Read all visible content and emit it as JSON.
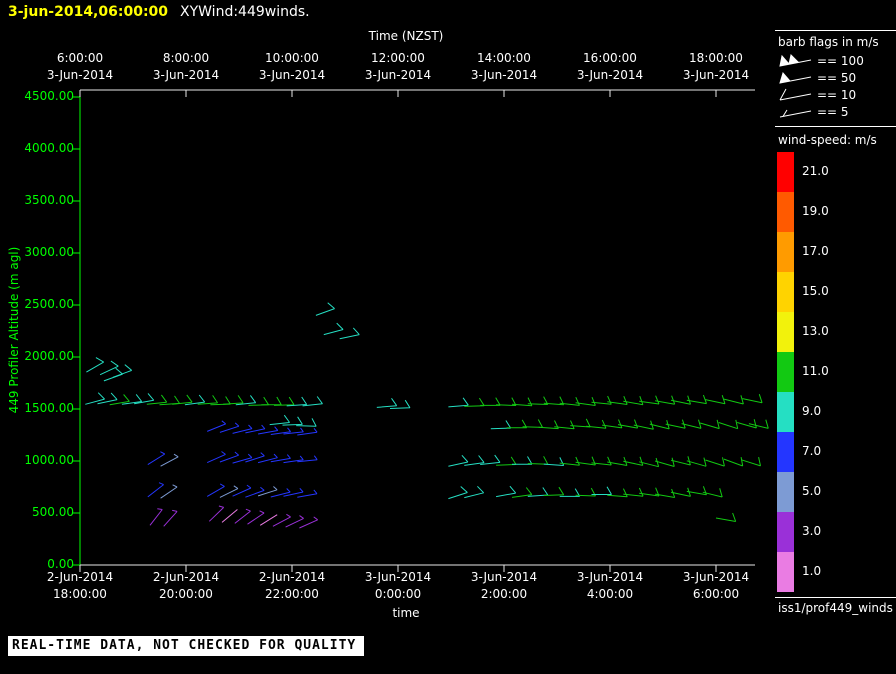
{
  "header": {
    "timestamp": "3-jun-2014,06:00:00",
    "title": "XYWind:449winds."
  },
  "chart_data": {
    "type": "windbarb-time-height",
    "top_axis": {
      "title": "Time (NZST)",
      "ticks": [
        {
          "time": "6:00:00",
          "date": "3-Jun-2014"
        },
        {
          "time": "8:00:00",
          "date": "3-Jun-2014"
        },
        {
          "time": "10:00:00",
          "date": "3-Jun-2014"
        },
        {
          "time": "12:00:00",
          "date": "3-Jun-2014"
        },
        {
          "time": "14:00:00",
          "date": "3-Jun-2014"
        },
        {
          "time": "16:00:00",
          "date": "3-Jun-2014"
        },
        {
          "time": "18:00:00",
          "date": "3-Jun-2014"
        }
      ]
    },
    "bottom_axis": {
      "title": "time",
      "ticks": [
        {
          "date": "2-Jun-2014",
          "time": "18:00:00"
        },
        {
          "date": "2-Jun-2014",
          "time": "20:00:00"
        },
        {
          "date": "2-Jun-2014",
          "time": "22:00:00"
        },
        {
          "date": "3-Jun-2014",
          "time": "0:00:00"
        },
        {
          "date": "3-Jun-2014",
          "time": "2:00:00"
        },
        {
          "date": "3-Jun-2014",
          "time": "4:00:00"
        },
        {
          "date": "3-Jun-2014",
          "time": "6:00:00"
        }
      ]
    },
    "y_axis": {
      "title": "449 Profiler Altitude (m agl)",
      "min": 0,
      "max": 4500,
      "ticks": [
        "0.00",
        "500.00",
        "1000.00",
        "1500.00",
        "2000.00",
        "2500.00",
        "3000.00",
        "3500.00",
        "4000.00",
        "4500.00"
      ]
    },
    "x_hours_range": [
      0,
      12.7
    ],
    "barb_fields": [
      "t_hours_from_plot_start",
      "altitude_m_agl",
      "speed_m_s",
      "direction_deg"
    ],
    "barbs": [
      [
        0.12,
        1855,
        9,
        60
      ],
      [
        0.38,
        1830,
        9,
        65
      ],
      [
        0.62,
        1805,
        9,
        70
      ],
      [
        0.45,
        1770,
        8,
        70
      ],
      [
        0.1,
        1545,
        9,
        75
      ],
      [
        0.33,
        1550,
        9,
        78
      ],
      [
        0.56,
        1540,
        10,
        80
      ],
      [
        0.79,
        1545,
        9,
        82
      ],
      [
        1.02,
        1550,
        9,
        80
      ],
      [
        1.26,
        1545,
        10,
        84
      ],
      [
        1.5,
        1540,
        11,
        86
      ],
      [
        1.74,
        1545,
        10,
        84
      ],
      [
        1.98,
        1540,
        9,
        82
      ],
      [
        2.22,
        1545,
        10,
        86
      ],
      [
        2.46,
        1540,
        11,
        88
      ],
      [
        2.7,
        1545,
        10,
        86
      ],
      [
        2.94,
        1540,
        9,
        84
      ],
      [
        3.18,
        1535,
        10,
        88
      ],
      [
        3.42,
        1540,
        11,
        90
      ],
      [
        3.66,
        1535,
        10,
        88
      ],
      [
        3.9,
        1530,
        9,
        86
      ],
      [
        4.2,
        1530,
        9,
        84
      ],
      [
        5.6,
        1515,
        9,
        85
      ],
      [
        5.85,
        1505,
        9,
        88
      ],
      [
        6.95,
        1520,
        9,
        85
      ],
      [
        7.25,
        1525,
        10,
        88
      ],
      [
        7.55,
        1535,
        11,
        90
      ],
      [
        7.85,
        1540,
        10,
        92
      ],
      [
        8.15,
        1545,
        11,
        94
      ],
      [
        8.45,
        1550,
        11,
        92
      ],
      [
        8.75,
        1555,
        10,
        94
      ],
      [
        9.05,
        1555,
        11,
        96
      ],
      [
        9.35,
        1560,
        11,
        98
      ],
      [
        9.65,
        1565,
        10,
        96
      ],
      [
        9.95,
        1570,
        11,
        98
      ],
      [
        10.25,
        1575,
        11,
        100
      ],
      [
        10.55,
        1575,
        10,
        98
      ],
      [
        10.85,
        1580,
        11,
        100
      ],
      [
        11.15,
        1585,
        11,
        102
      ],
      [
        11.45,
        1585,
        10,
        100
      ],
      [
        11.8,
        1590,
        11,
        102
      ],
      [
        12.15,
        1595,
        11,
        104
      ],
      [
        12.5,
        1600,
        11,
        102
      ],
      [
        4.45,
        2400,
        9,
        70
      ],
      [
        4.6,
        2215,
        9,
        75
      ],
      [
        4.9,
        2175,
        9,
        78
      ],
      [
        2.4,
        1285,
        7,
        68
      ],
      [
        2.64,
        1275,
        7,
        72
      ],
      [
        2.88,
        1265,
        7,
        76
      ],
      [
        3.12,
        1270,
        7,
        78
      ],
      [
        3.36,
        1260,
        7,
        80
      ],
      [
        3.6,
        1255,
        7,
        82
      ],
      [
        3.84,
        1260,
        7,
        84
      ],
      [
        4.1,
        1250,
        7,
        82
      ],
      [
        3.58,
        1350,
        9,
        84
      ],
      [
        3.82,
        1345,
        9,
        88
      ],
      [
        4.08,
        1340,
        9,
        92
      ],
      [
        7.75,
        1310,
        9,
        88
      ],
      [
        8.05,
        1320,
        10,
        90
      ],
      [
        8.35,
        1330,
        11,
        92
      ],
      [
        8.65,
        1325,
        10,
        94
      ],
      [
        8.95,
        1330,
        11,
        96
      ],
      [
        9.25,
        1340,
        11,
        94
      ],
      [
        9.55,
        1335,
        10,
        96
      ],
      [
        9.85,
        1345,
        11,
        98
      ],
      [
        10.15,
        1350,
        11,
        100
      ],
      [
        10.45,
        1345,
        10,
        102
      ],
      [
        10.75,
        1355,
        11,
        104
      ],
      [
        11.05,
        1355,
        11,
        102
      ],
      [
        11.35,
        1360,
        10,
        104
      ],
      [
        11.7,
        1365,
        11,
        106
      ],
      [
        12.05,
        1370,
        11,
        108
      ],
      [
        12.4,
        1370,
        11,
        106
      ],
      [
        12.62,
        1360,
        11,
        104
      ],
      [
        1.28,
        965,
        7,
        58
      ],
      [
        1.52,
        950,
        5,
        62
      ],
      [
        2.4,
        985,
        7,
        66
      ],
      [
        2.64,
        990,
        7,
        70
      ],
      [
        2.88,
        980,
        7,
        74
      ],
      [
        3.12,
        990,
        7,
        72
      ],
      [
        3.36,
        985,
        7,
        76
      ],
      [
        3.6,
        992,
        7,
        80
      ],
      [
        3.84,
        985,
        7,
        82
      ],
      [
        4.1,
        992,
        7,
        84
      ],
      [
        6.95,
        950,
        9,
        78
      ],
      [
        7.25,
        958,
        9,
        82
      ],
      [
        7.55,
        966,
        9,
        84
      ],
      [
        7.85,
        960,
        10,
        88
      ],
      [
        8.15,
        968,
        9,
        90
      ],
      [
        8.45,
        976,
        10,
        92
      ],
      [
        8.75,
        970,
        9,
        94
      ],
      [
        9.05,
        980,
        10,
        96
      ],
      [
        9.35,
        988,
        11,
        98
      ],
      [
        9.65,
        982,
        10,
        96
      ],
      [
        9.95,
        990,
        11,
        100
      ],
      [
        10.25,
        998,
        10,
        102
      ],
      [
        10.55,
        992,
        11,
        104
      ],
      [
        10.85,
        1000,
        11,
        106
      ],
      [
        11.15,
        1008,
        10,
        104
      ],
      [
        11.45,
        1002,
        11,
        106
      ],
      [
        11.8,
        1010,
        11,
        108
      ],
      [
        12.15,
        1018,
        11,
        110
      ],
      [
        12.48,
        1012,
        11,
        108
      ],
      [
        1.28,
        655,
        7,
        52
      ],
      [
        1.52,
        642,
        5,
        56
      ],
      [
        2.4,
        660,
        7,
        60
      ],
      [
        2.64,
        650,
        5,
        64
      ],
      [
        2.88,
        662,
        7,
        66
      ],
      [
        3.12,
        652,
        7,
        70
      ],
      [
        3.36,
        664,
        5,
        72
      ],
      [
        3.6,
        654,
        7,
        76
      ],
      [
        3.84,
        662,
        7,
        78
      ],
      [
        4.1,
        652,
        7,
        80
      ],
      [
        6.95,
        638,
        9,
        72
      ],
      [
        7.25,
        648,
        9,
        76
      ],
      [
        7.85,
        658,
        9,
        80
      ],
      [
        8.15,
        650,
        10,
        82
      ],
      [
        8.45,
        660,
        9,
        86
      ],
      [
        8.75,
        668,
        10,
        88
      ],
      [
        9.05,
        660,
        9,
        90
      ],
      [
        9.35,
        670,
        10,
        92
      ],
      [
        9.65,
        678,
        9,
        90
      ],
      [
        9.95,
        670,
        10,
        94
      ],
      [
        10.25,
        682,
        11,
        96
      ],
      [
        10.55,
        690,
        10,
        98
      ],
      [
        10.85,
        682,
        11,
        100
      ],
      [
        11.15,
        700,
        11,
        102
      ],
      [
        11.45,
        708,
        10,
        100
      ],
      [
        11.75,
        700,
        11,
        104
      ],
      [
        1.32,
        382,
        3,
        38
      ],
      [
        1.58,
        372,
        3,
        42
      ],
      [
        2.44,
        420,
        3,
        46
      ],
      [
        2.68,
        410,
        1,
        50
      ],
      [
        2.92,
        400,
        3,
        52
      ],
      [
        3.16,
        392,
        3,
        56
      ],
      [
        3.4,
        382,
        1,
        58
      ],
      [
        3.64,
        372,
        3,
        62
      ],
      [
        3.88,
        364,
        3,
        64
      ],
      [
        4.14,
        356,
        3,
        66
      ],
      [
        12.0,
        452,
        11,
        100
      ]
    ]
  },
  "legend": {
    "barb_flags": {
      "title": "barb flags in m/s",
      "items": [
        {
          "value": 100,
          "label": "== 100"
        },
        {
          "value": 50,
          "label": "== 50"
        },
        {
          "value": 10,
          "label": "== 10"
        },
        {
          "value": 5,
          "label": "== 5"
        }
      ]
    },
    "colorbar": {
      "title": "wind-speed: m/s",
      "entries": [
        {
          "value": "21.0",
          "color": "#ff0000"
        },
        {
          "value": "19.0",
          "color": "#ff5a00"
        },
        {
          "value": "17.0",
          "color": "#ff9b00"
        },
        {
          "value": "15.0",
          "color": "#ffd300"
        },
        {
          "value": "13.0",
          "color": "#f2f20c"
        },
        {
          "value": "11.0",
          "color": "#12c912"
        },
        {
          "value": "9.0",
          "color": "#25dfc3"
        },
        {
          "value": "7.0",
          "color": "#2436ff"
        },
        {
          "value": "5.0",
          "color": "#7d9bd4"
        },
        {
          "value": "3.0",
          "color": "#9a30d8"
        },
        {
          "value": "1.0",
          "color": "#ea7ce3"
        }
      ]
    }
  },
  "footer": {
    "source": "iss1/prof449_winds",
    "quality_note": "REAL-TIME DATA, NOT CHECKED FOR QUALITY"
  }
}
